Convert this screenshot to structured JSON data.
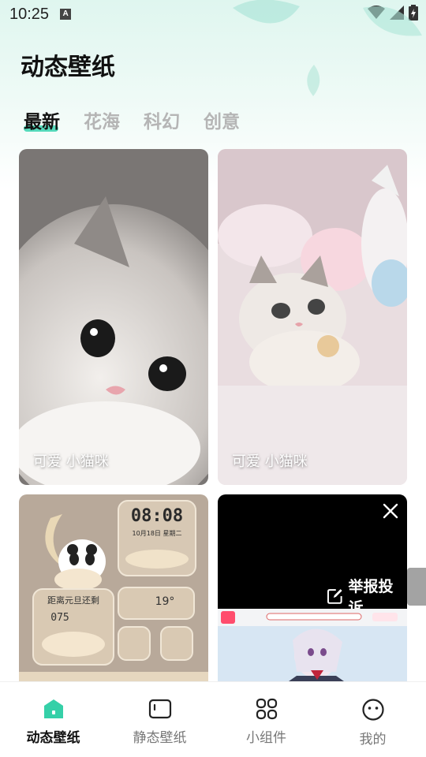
{
  "status_bar": {
    "time": "10:25",
    "notification_icon_letter": "A",
    "icons": [
      "wifi-icon",
      "signal-icon",
      "battery-icon"
    ]
  },
  "page": {
    "title": "动态壁纸"
  },
  "tabs": [
    {
      "label": "最新",
      "active": true
    },
    {
      "label": "花海",
      "active": false
    },
    {
      "label": "科幻",
      "active": false
    },
    {
      "label": "创意",
      "active": false
    }
  ],
  "cards": [
    {
      "caption": "可爱 小猫咪"
    },
    {
      "caption": "可爱 小猫咪"
    },
    {
      "caption": "",
      "clock_text": "08:08",
      "date_text": "10月18日 星期二",
      "countdown_label": "距离元旦还剩",
      "countdown_value": "075",
      "temperature": "19°"
    },
    {
      "caption": ""
    }
  ],
  "ad": {
    "report_label": "举报投诉"
  },
  "bottom_nav": [
    {
      "label": "动态壁纸",
      "icon": "house-icon",
      "active": true
    },
    {
      "label": "静态壁纸",
      "icon": "picture-icon",
      "active": false
    },
    {
      "label": "小组件",
      "icon": "widgets-icon",
      "active": false
    },
    {
      "label": "我的",
      "icon": "profile-face-icon",
      "active": false
    }
  ],
  "colors": {
    "accent": "#39d3b2",
    "inactive_tab": "#b5b5b5"
  }
}
